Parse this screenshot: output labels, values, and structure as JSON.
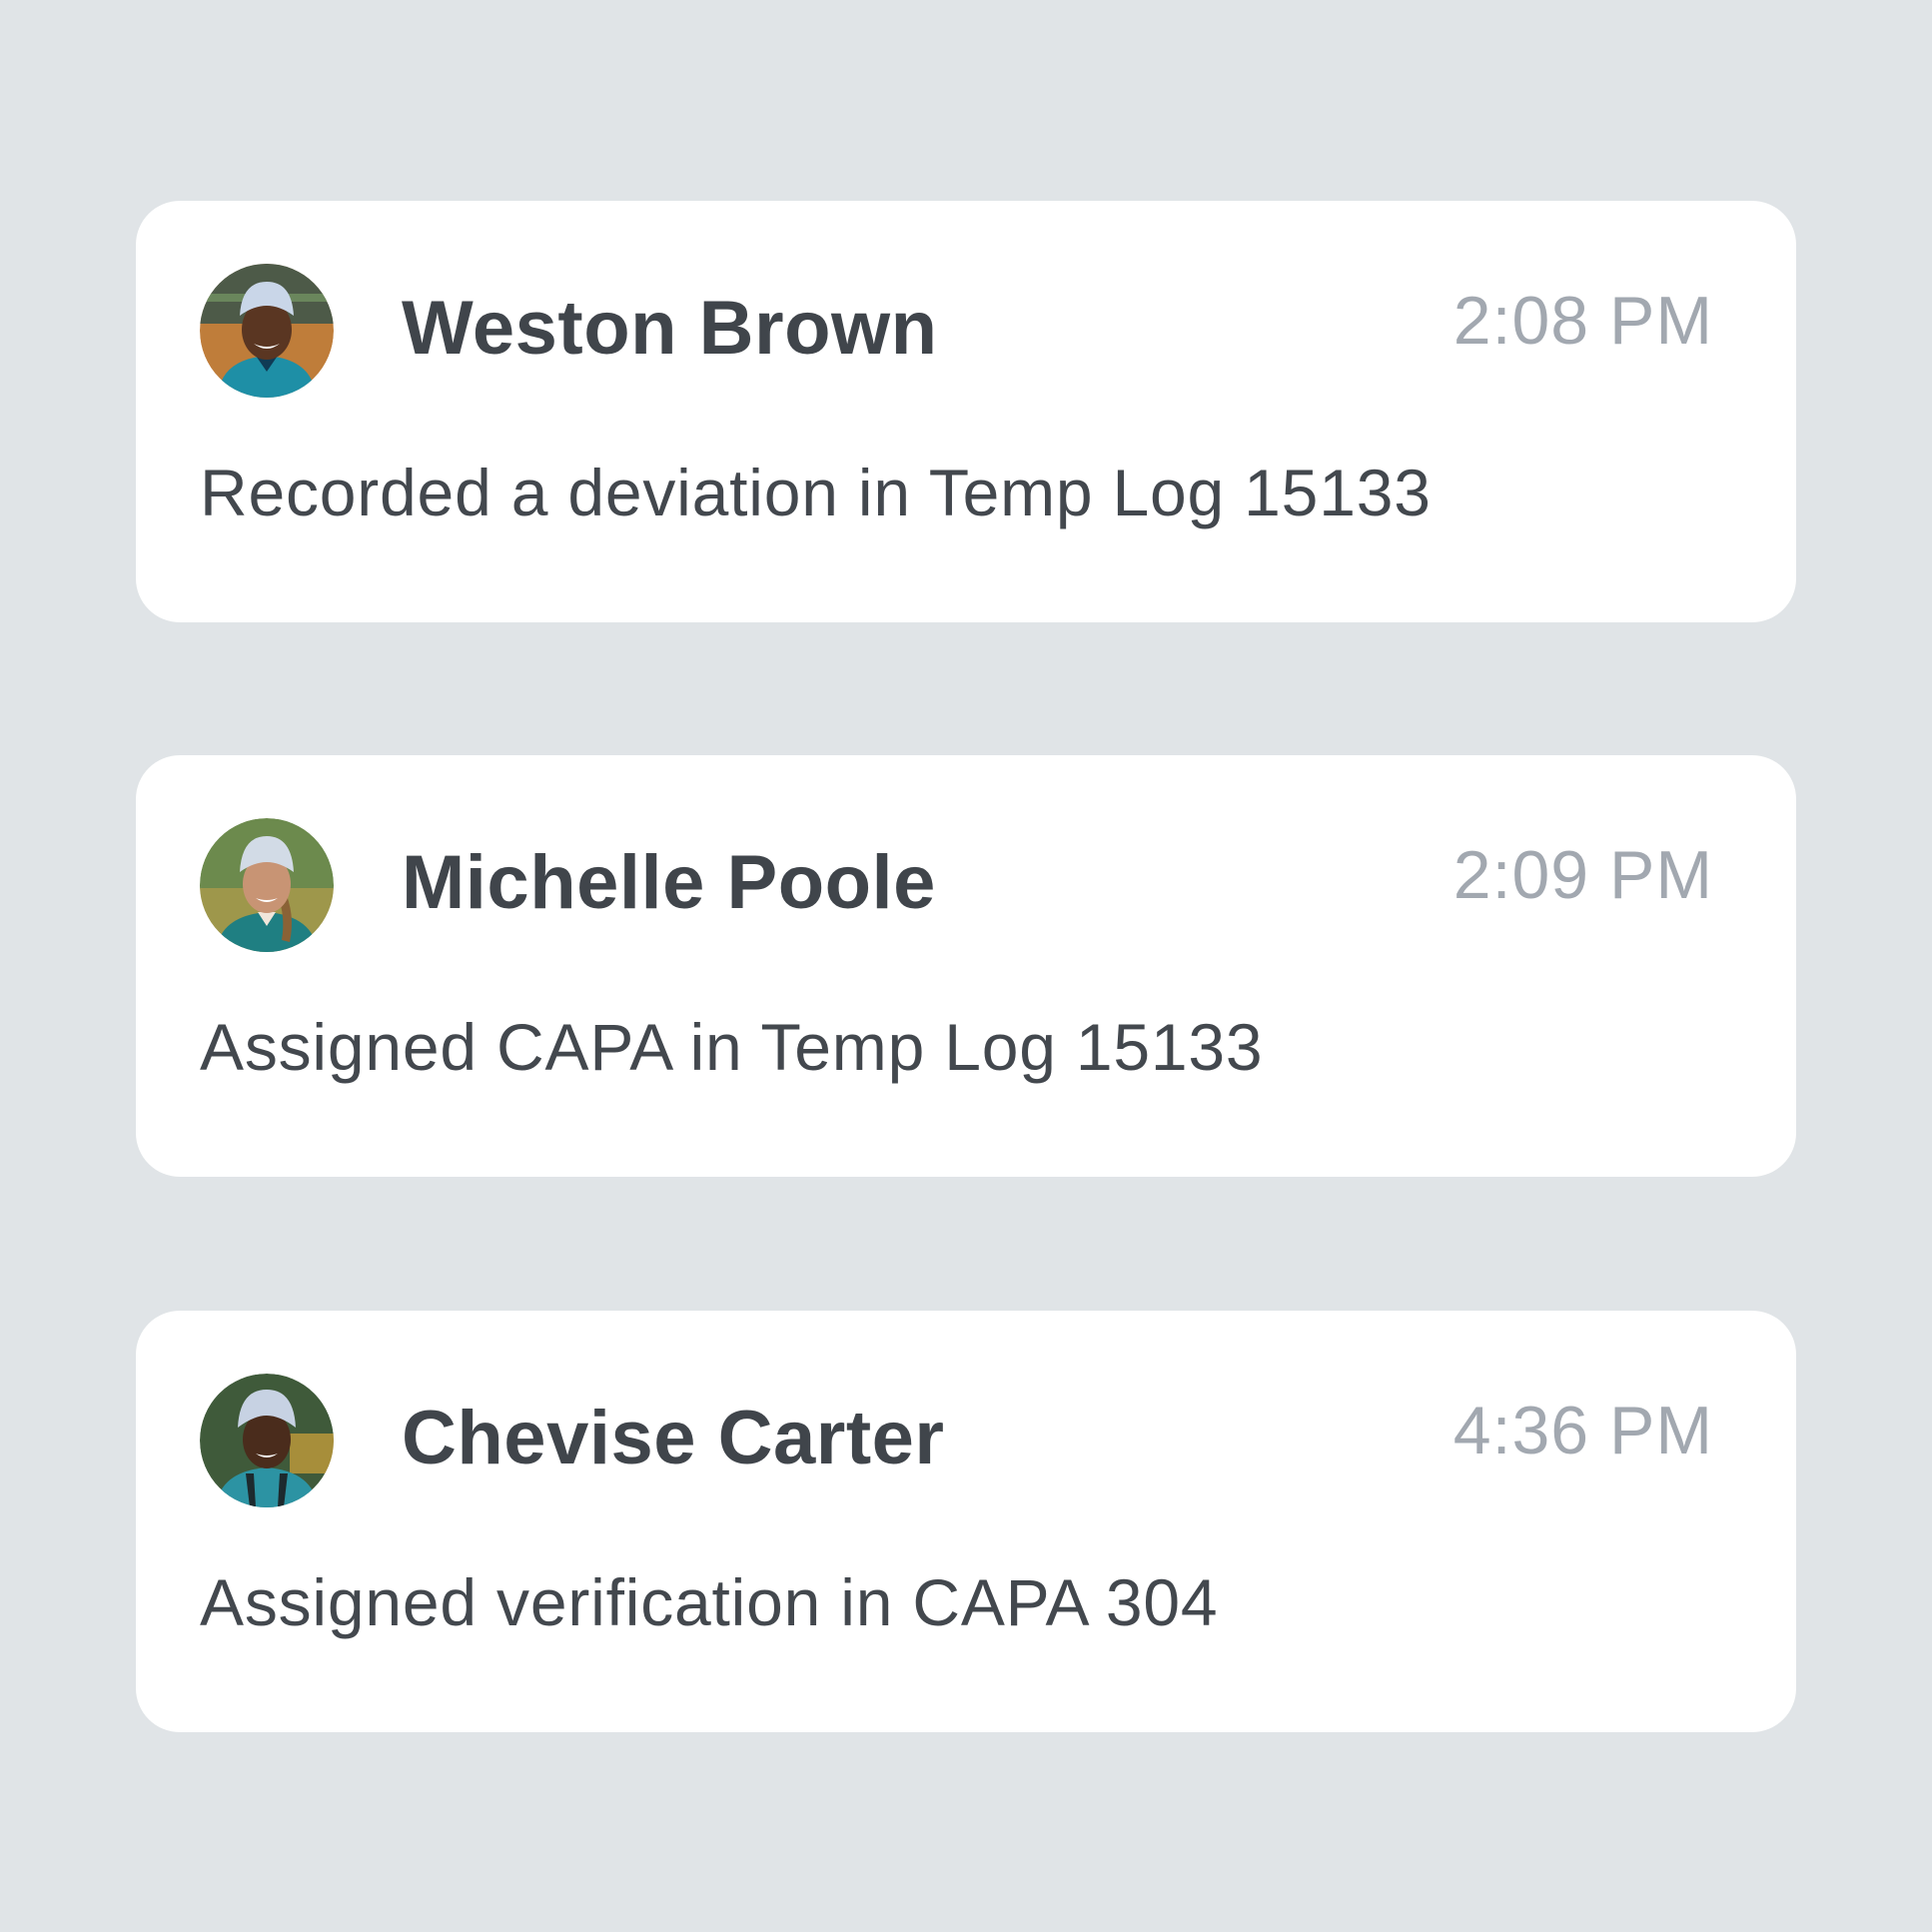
{
  "activity_feed": {
    "items": [
      {
        "name": "Weston Brown",
        "time": "2:08 PM",
        "message": "Recorded a deviation in Temp Log 15133",
        "avatar_icon": "person-avatar-hairnet-male",
        "colors": {
          "background": "#bf7d3a",
          "skin": "#5a3622",
          "shirt": "#1e8fa6",
          "hat": "#c9d6e8"
        }
      },
      {
        "name": "Michelle Poole",
        "time": "2:09 PM",
        "message": "Assigned CAPA in Temp Log 15133",
        "avatar_icon": "person-avatar-hairnet-female",
        "colors": {
          "background": "#6c8a4d",
          "skin": "#c89474",
          "shirt": "#1f7f82",
          "hat": "#d2dbe6"
        }
      },
      {
        "name": "Chevise Carter",
        "time": "4:36 PM",
        "message": "Assigned verification in CAPA 304",
        "avatar_icon": "person-avatar-hairnet-female",
        "colors": {
          "background": "#3f5a3a",
          "skin": "#4a2c1c",
          "shirt": "#2c93a3",
          "hat": "#c7d2e3"
        }
      }
    ]
  },
  "theme": {
    "page_background": "#e0e4e7",
    "card_background": "#ffffff",
    "name_color": "#40454b",
    "time_color": "#a2a8b0",
    "message_color": "#43484e"
  }
}
